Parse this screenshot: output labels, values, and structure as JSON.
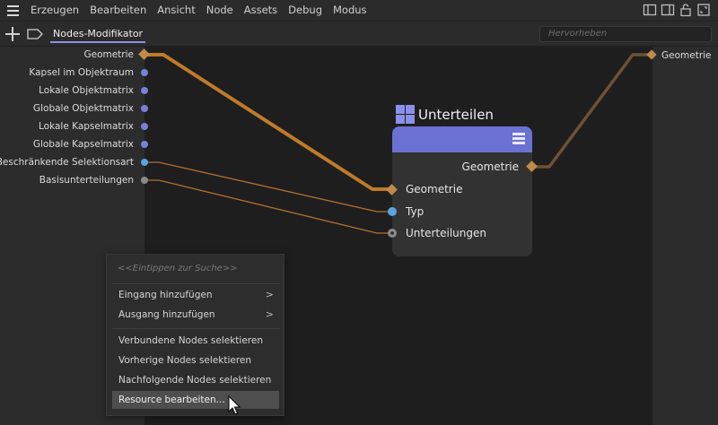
{
  "menubar": {
    "items": [
      "Erzeugen",
      "Bearbeiten",
      "Ansicht",
      "Node",
      "Assets",
      "Debug",
      "Modus"
    ],
    "right_icons": [
      "layout-left-icon",
      "layout-right-icon",
      "lock-icon",
      "expand-icon"
    ]
  },
  "tabrow": {
    "tab_label": "Nodes-Modifikator",
    "search_placeholder": "Hervorheben"
  },
  "left_ports": [
    {
      "label": "Geometrie",
      "type": "geometry",
      "color": "#c08a4a"
    },
    {
      "label": "Kapsel im Objektraum",
      "type": "object",
      "color": "#7a7fd8"
    },
    {
      "label": "Lokale Objektmatrix",
      "type": "matrix",
      "color": "#7a7fd8"
    },
    {
      "label": "Globale Objektmatrix",
      "type": "matrix",
      "color": "#7a7fd8"
    },
    {
      "label": "Lokale Kapselmatrix",
      "type": "matrix",
      "color": "#7a7fd8"
    },
    {
      "label": "Globale Kapselmatrix",
      "type": "matrix",
      "color": "#7a7fd8"
    },
    {
      "label": "Beschränkende Selektionsart",
      "type": "integer",
      "color": "#5aa3e0"
    },
    {
      "label": "Basisunterteilungen",
      "type": "number",
      "color": "#8a8a8a"
    }
  ],
  "right_port": {
    "label": "Geometrie"
  },
  "node": {
    "title": "Unterteilen",
    "output": "Geometrie",
    "inputs": [
      "Geometrie",
      "Typ",
      "Unterteilungen"
    ],
    "header_color": "#6b71d3"
  },
  "context_menu": {
    "search_hint": "<<Eintippen zur Suche>>",
    "items": [
      {
        "label": "Eingang hinzufügen",
        "submenu": true
      },
      {
        "label": "Ausgang hinzufügen",
        "submenu": true
      },
      {
        "label": "Verbundene Nodes selektieren",
        "submenu": false
      },
      {
        "label": "Vorherige Nodes selektieren",
        "submenu": false
      },
      {
        "label": "Nachfolgende Nodes selektieren",
        "submenu": false
      },
      {
        "label": "Resource bearbeiten...",
        "submenu": false,
        "highlighted": true
      }
    ],
    "submenu_arrow": ">"
  },
  "colors": {
    "wire_geometry": "#c07a28",
    "wire_output": "#6e5235",
    "wire_thin": "#b07030",
    "accent": "#8a8fe0"
  }
}
